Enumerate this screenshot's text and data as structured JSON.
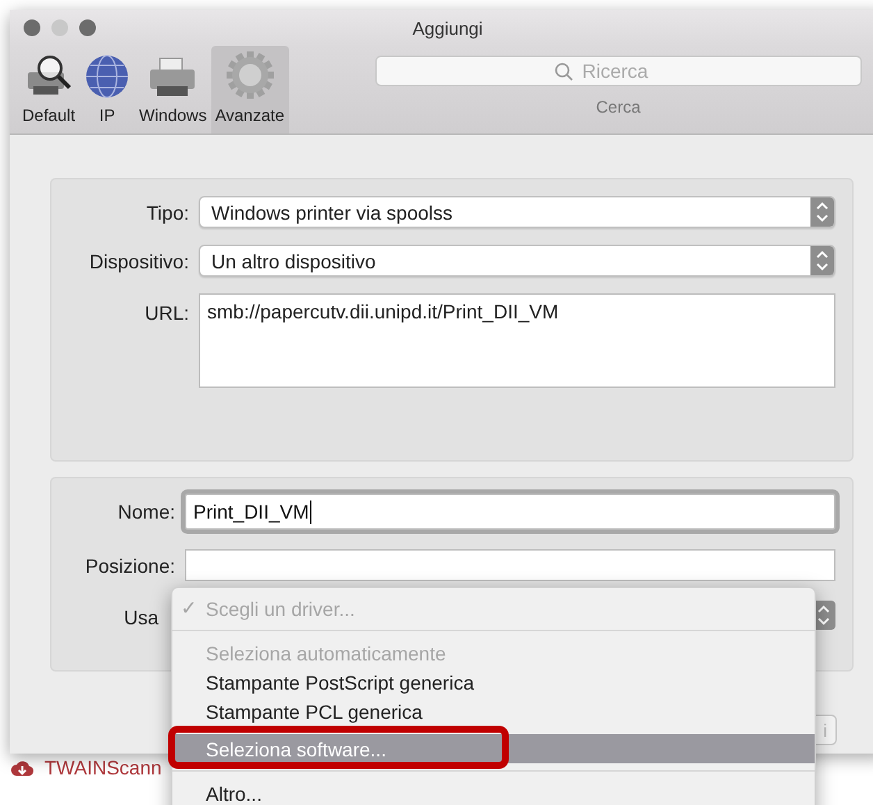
{
  "window": {
    "title": "Aggiungi"
  },
  "toolbar": {
    "tabs": [
      {
        "label": "Default",
        "selected": false
      },
      {
        "label": "IP",
        "selected": false
      },
      {
        "label": "Windows",
        "selected": false
      },
      {
        "label": "Avanzate",
        "selected": true
      }
    ],
    "search": {
      "placeholder": "Ricerca",
      "label": "Cerca"
    }
  },
  "connection": {
    "fields": [
      {
        "kind": "select",
        "label": "Tipo:",
        "value": "Windows printer via spoolss"
      },
      {
        "kind": "select",
        "label": "Dispositivo:",
        "value": "Un altro dispositivo"
      },
      {
        "kind": "textarea",
        "label": "URL:",
        "value": "smb://papercutv.dii.unipd.it/Print_DII_VM"
      }
    ]
  },
  "details": {
    "fields": [
      {
        "kind": "input",
        "label": "Nome:",
        "value": "Print_DII_VM",
        "focused": true
      },
      {
        "kind": "input",
        "label": "Posizione:",
        "focused": false
      },
      {
        "kind": "select",
        "label": "Usa"
      }
    ]
  },
  "add_button": {
    "label": "i"
  },
  "driver_menu": {
    "items": [
      {
        "kind": "item",
        "label": "Scegli un driver...",
        "check_mark": "✓",
        "disabled": true,
        "selected": false
      },
      {
        "kind": "separator"
      },
      {
        "kind": "item",
        "label": "Seleziona automaticamente",
        "disabled": true,
        "selected": false
      },
      {
        "kind": "item",
        "label": "Stampante PostScript generica",
        "disabled": false,
        "selected": false
      },
      {
        "kind": "item",
        "label": "Stampante PCL generica",
        "disabled": false,
        "selected": false
      },
      {
        "kind": "item",
        "label": "Seleziona software...",
        "disabled": false,
        "selected": true,
        "annotated": true
      },
      {
        "kind": "separator"
      },
      {
        "kind": "item",
        "label": "Altro...",
        "disabled": false,
        "selected": false
      }
    ]
  },
  "desktop": {
    "items": [
      {
        "label": "TWAINScann"
      }
    ]
  }
}
